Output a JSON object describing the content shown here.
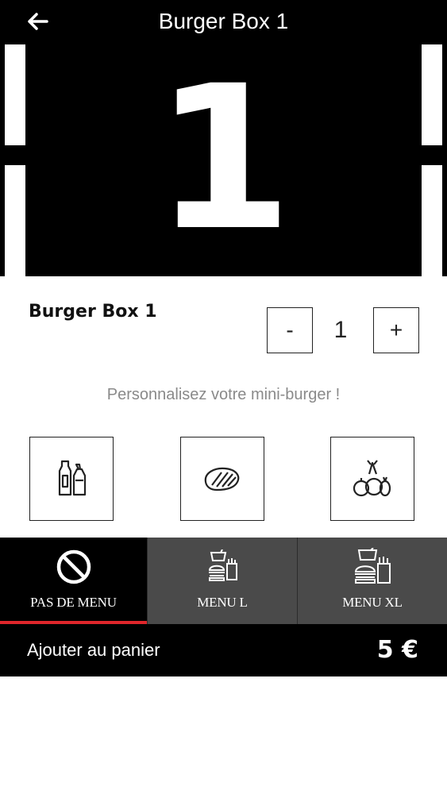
{
  "header": {
    "back_icon": "arrow-left-icon",
    "title": "Burger Box 1"
  },
  "hero": {
    "numeral": "1"
  },
  "product": {
    "name": "Burger Box 1",
    "quantity": "1",
    "decrement_label": "-",
    "increment_label": "+"
  },
  "customize": {
    "prompt": "Personnalisez votre mini-burger !",
    "options": [
      {
        "icon": "sauce-bottles-icon"
      },
      {
        "icon": "steak-icon"
      },
      {
        "icon": "vegetables-icon"
      }
    ]
  },
  "menu_tabs": [
    {
      "label": "PAS DE MENU",
      "icon": "no-symbol-icon",
      "active": true
    },
    {
      "label": "MENU L",
      "icon": "burger-menu-icon",
      "active": false
    },
    {
      "label": "MENU XL",
      "icon": "burger-menu-xl-icon",
      "active": false
    }
  ],
  "cart": {
    "label": "Ajouter au panier",
    "price": "5 €"
  },
  "colors": {
    "header_bg": "#000000",
    "tab_bg": "#4a4a4a",
    "tab_active_bg": "#000000",
    "tab_active_underline": "#e0262b",
    "subtitle_text": "#8a8a8a"
  }
}
